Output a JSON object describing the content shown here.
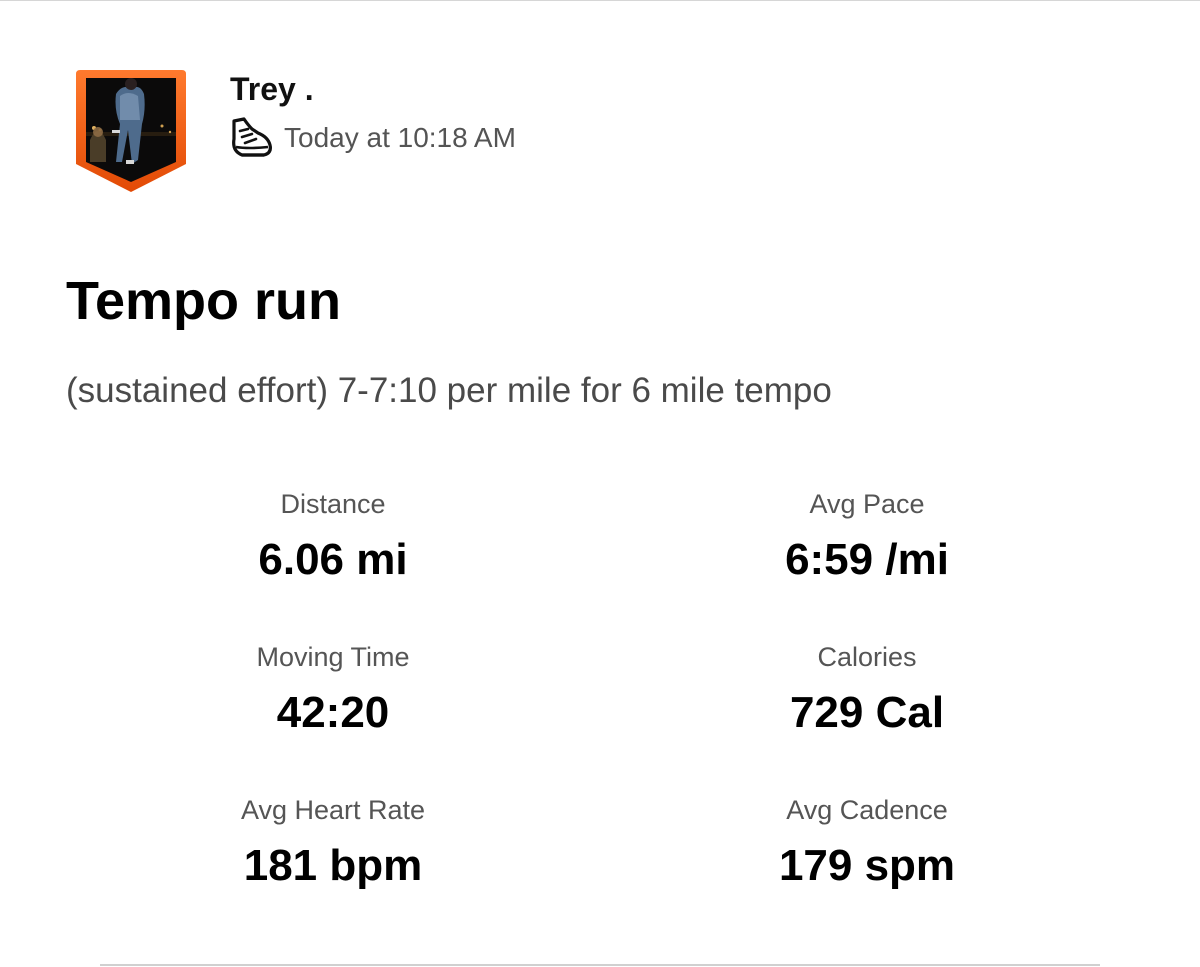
{
  "athlete": {
    "name": "Trey .",
    "avatar": "athlete-photo"
  },
  "activity": {
    "sport_icon": "running-shoe-icon",
    "timestamp": "Today at 10:18 AM",
    "title": "Tempo run",
    "description": "(sustained effort) 7-7:10 per mile for 6 mile tempo"
  },
  "stats": [
    {
      "label": "Distance",
      "value": "6.06 mi"
    },
    {
      "label": "Avg Pace",
      "value": "6:59 /mi"
    },
    {
      "label": "Moving Time",
      "value": "42:20"
    },
    {
      "label": "Calories",
      "value": "729 Cal"
    },
    {
      "label": "Avg Heart Rate",
      "value": "181 bpm"
    },
    {
      "label": "Avg Cadence",
      "value": "179 spm"
    }
  ],
  "colors": {
    "accent_orange": "#fc4c02",
    "badge_gradient_top": "#ff7a2e",
    "badge_gradient_bottom": "#e24a05",
    "secondary_text": "#545454"
  }
}
